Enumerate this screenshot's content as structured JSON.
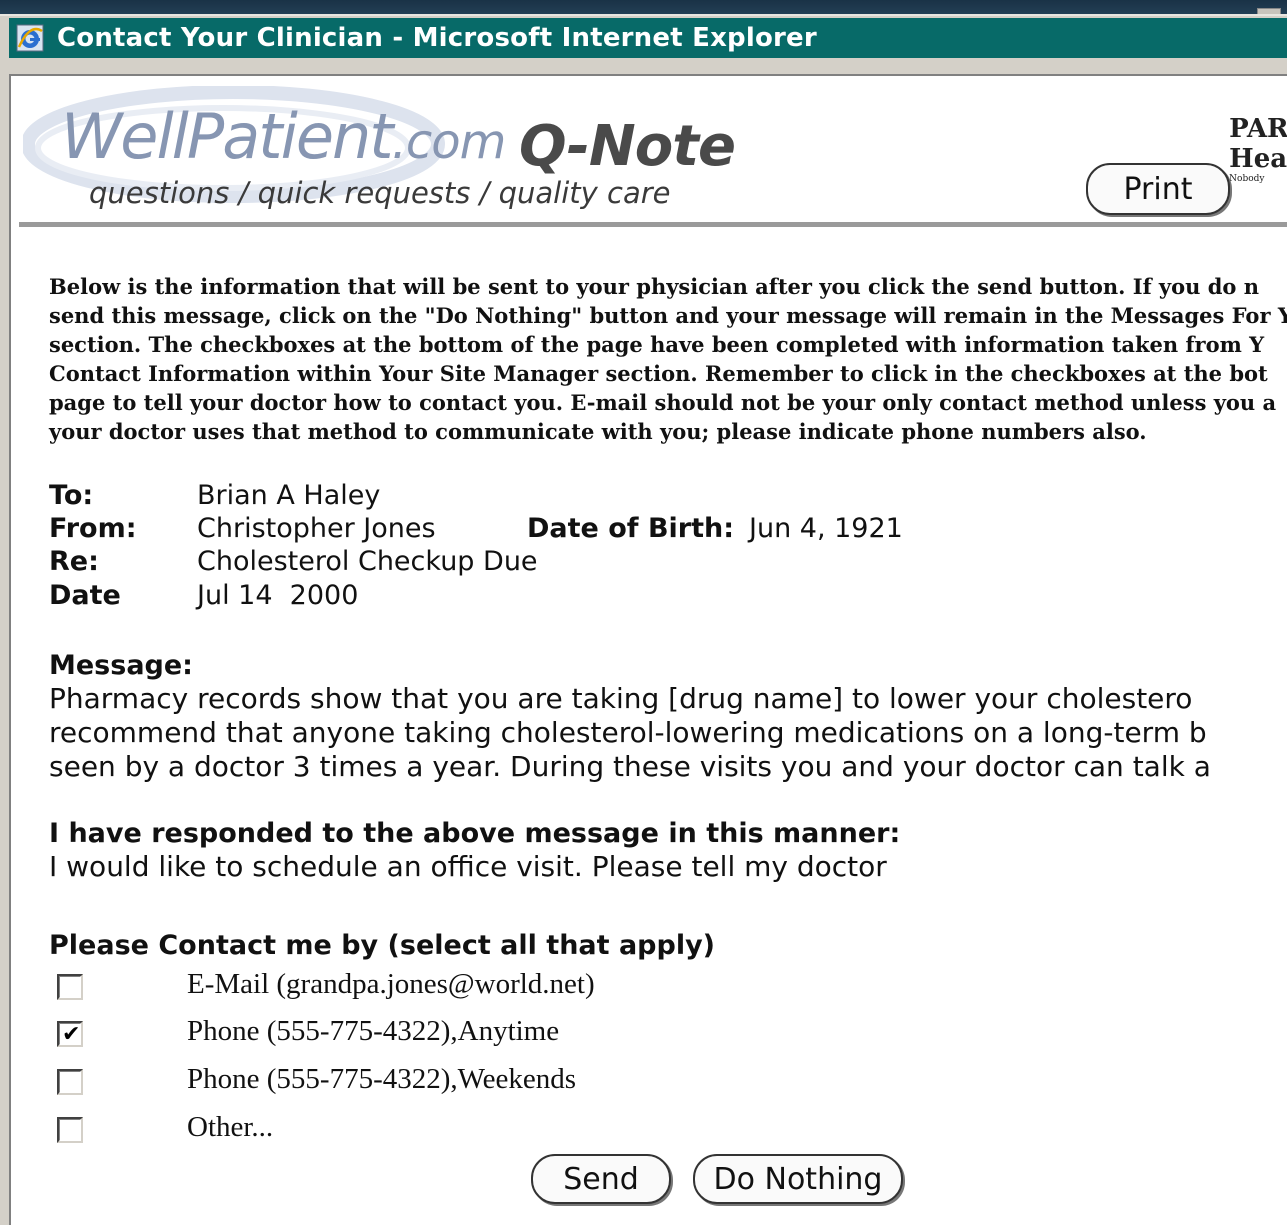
{
  "window": {
    "title": "Contact Your Clinician - Microsoft Internet Explorer"
  },
  "header": {
    "brand_main": "WellPatient",
    "brand_suffix": ".com",
    "product": "Q-Note",
    "tagline": "questions / quick requests / quality care",
    "partner_line1": "PAR",
    "partner_line2": "Heal",
    "partner_small": "Nobody",
    "print_label": "Print"
  },
  "intro": {
    "lines": [
      "Below is the information that will be sent to your physician after you click the send button. If you do n",
      "send this message, click on the \"Do Nothing\" button and your message will remain in the Messages For Y",
      "section. The checkboxes at the bottom of the page have been completed with information taken from Y",
      "Contact Information within Your Site Manager section. Remember to click in the checkboxes at the bot",
      "page to tell your doctor how to contact you. E-mail should not be your only contact method unless you a",
      "your doctor uses that method to communicate with you; please indicate phone numbers also."
    ]
  },
  "message_header": {
    "to_label": "To:",
    "to_value": "Brian A Haley",
    "from_label": "From:",
    "from_value": "Christopher Jones",
    "dob_label": "Date of Birth:",
    "dob_value": "Jun 4, 1921",
    "re_label": "Re:",
    "re_value": "Cholesterol Checkup Due",
    "date_label": "Date",
    "date_value": "Jul 14  2000"
  },
  "message": {
    "label": "Message:",
    "lines": [
      "Pharmacy records show that you are taking [drug name] to lower your cholestero",
      "recommend that anyone taking cholesterol-lowering medications on a long-term b",
      "seen by a doctor 3 times a year. During these visits you and your doctor can talk a"
    ]
  },
  "response": {
    "label": "I have responded to the above message in this manner:",
    "text": "I would like to schedule an office visit. Please tell my doctor"
  },
  "contact": {
    "label": "Please Contact me by (select all that apply)",
    "options": [
      {
        "label": "E-Mail (grandpa.jones@world.net)",
        "checked": false
      },
      {
        "label": "Phone (555-775-4322),Anytime",
        "checked": true
      },
      {
        "label": "Phone (555-775-4322),Weekends",
        "checked": false
      },
      {
        "label": "Other...",
        "checked": false
      }
    ]
  },
  "actions": {
    "send_label": "Send",
    "do_nothing_label": "Do Nothing"
  },
  "colors": {
    "titlebar": "#076a68",
    "brand_text": "#8796b2"
  }
}
